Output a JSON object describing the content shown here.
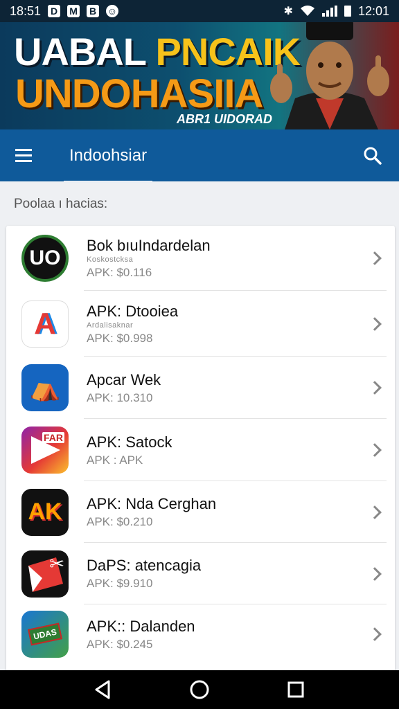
{
  "status_bar": {
    "time_left": "18:51",
    "time_right": "12:01",
    "notif_icons": [
      "D",
      "M",
      "B",
      "☺"
    ]
  },
  "banner": {
    "line1_a": "UABAL ",
    "line1_b": "PNCAIK",
    "line2": "UNDOHASIIA",
    "subtitle": "ABR1 UIDORAD"
  },
  "app_bar": {
    "title": "Indoohsiar"
  },
  "section_label": "Poolaa ı hacias:",
  "items": [
    {
      "title": "Bok bıuIndardelan",
      "subtitle": "Koskostcksa",
      "meta": "APK: $0.116",
      "icon_text": "UO",
      "icon": "uo-icon"
    },
    {
      "title": "APK: Dtooiea",
      "subtitle": "Ardalisaknar",
      "meta": "APK: $0.998",
      "icon_text": "A",
      "icon": "a-logo-icon"
    },
    {
      "title": "Apcar Wek",
      "subtitle": "",
      "meta": "APK: 10.310",
      "icon_text": "⛺",
      "icon": "tent-icon"
    },
    {
      "title": "APK: Satock",
      "subtitle": "",
      "meta": "APK : APK",
      "icon_text": "FAR",
      "icon": "play-triangle-icon"
    },
    {
      "title": "APK: Nda Cerghan",
      "subtitle": "",
      "meta": "APK: $0.210",
      "icon_text": "AK",
      "icon": "ak-icon"
    },
    {
      "title": "DaPS: atencagia",
      "subtitle": "",
      "meta": "APK: $9.910",
      "icon_text": "✂",
      "icon": "red-card-icon"
    },
    {
      "title": "APK:: Dalanden",
      "subtitle": "",
      "meta": "APK: $0.245",
      "icon_text": "UDAS",
      "icon": "banknote-icon"
    }
  ]
}
